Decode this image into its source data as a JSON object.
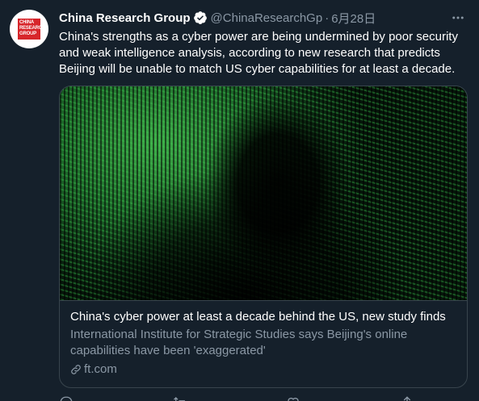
{
  "tweet": {
    "avatar_logo_lines": [
      "CHINA",
      "RESEARCH",
      "GROUP"
    ],
    "display_name": "China Research Group",
    "verified_icon": "verified-badge-icon",
    "handle": "@ChinaResearchGp",
    "separator": "·",
    "timestamp": "6月28日",
    "more_icon": "more-options-icon",
    "text": "China's strengths as a cyber power are being undermined by poor security and weak intelligence analysis, according to new research that predicts Beijing will be unable to match US cyber capabilities for at least a decade."
  },
  "card": {
    "image_description": "hacker-silhouette-binary-code-image",
    "title": "China's cyber power at least a decade behind the US, new study finds",
    "description": "International Institute for Strategic Studies says Beijing's online capabilities have been 'exaggerated'",
    "domain": "ft.com",
    "link_icon": "link-icon"
  },
  "actions": {
    "icons": [
      "reply-icon",
      "retweet-icon",
      "like-icon",
      "share-icon"
    ]
  },
  "colors": {
    "background": "#15202b",
    "primary_text": "#ffffff",
    "secondary_text": "#8b98a5",
    "border": "#38444d",
    "verified": "#ffffff",
    "brand_red": "#d7262b"
  }
}
